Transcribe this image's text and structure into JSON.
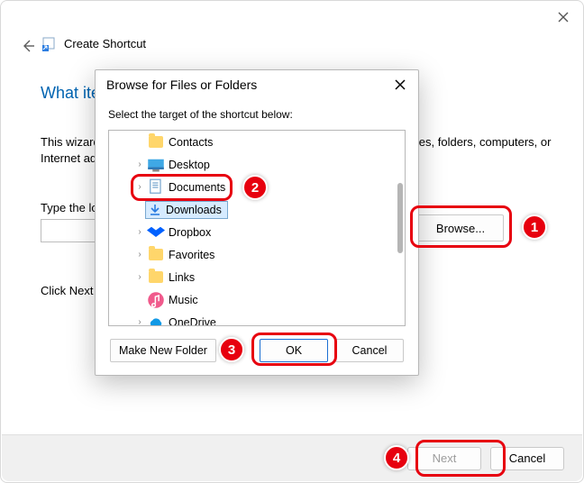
{
  "wizard": {
    "title": "Create Shortcut",
    "heading_partial": "What ite",
    "description": "This wizard helps you to create shortcuts to local or network programs, files, folders, computers, or Internet addresses.",
    "type_loc_partial": "Type the lo",
    "browse_label": "Browse...",
    "click_next_partial": "Click Next",
    "next_label": "Next",
    "cancel_label": "Cancel"
  },
  "dialog": {
    "title": "Browse for Files or Folders",
    "subtitle": "Select the target of the shortcut below:",
    "make_new_label": "Make New Folder",
    "ok_label": "OK",
    "cancel_label": "Cancel",
    "items": [
      {
        "label": "Contacts",
        "has_children": false,
        "icon": "folder"
      },
      {
        "label": "Desktop",
        "has_children": true,
        "icon": "desktop"
      },
      {
        "label": "Documents",
        "has_children": true,
        "icon": "documents"
      },
      {
        "label": "Downloads",
        "has_children": false,
        "icon": "downloads",
        "selected": true
      },
      {
        "label": "Dropbox",
        "has_children": true,
        "icon": "dropbox"
      },
      {
        "label": "Favorites",
        "has_children": true,
        "icon": "folder"
      },
      {
        "label": "Links",
        "has_children": true,
        "icon": "folder"
      },
      {
        "label": "Music",
        "has_children": false,
        "icon": "music"
      },
      {
        "label": "OneDrive",
        "has_children": true,
        "icon": "onedrive"
      }
    ]
  },
  "annotations": {
    "n1": "1",
    "n2": "2",
    "n3": "3",
    "n4": "4"
  }
}
